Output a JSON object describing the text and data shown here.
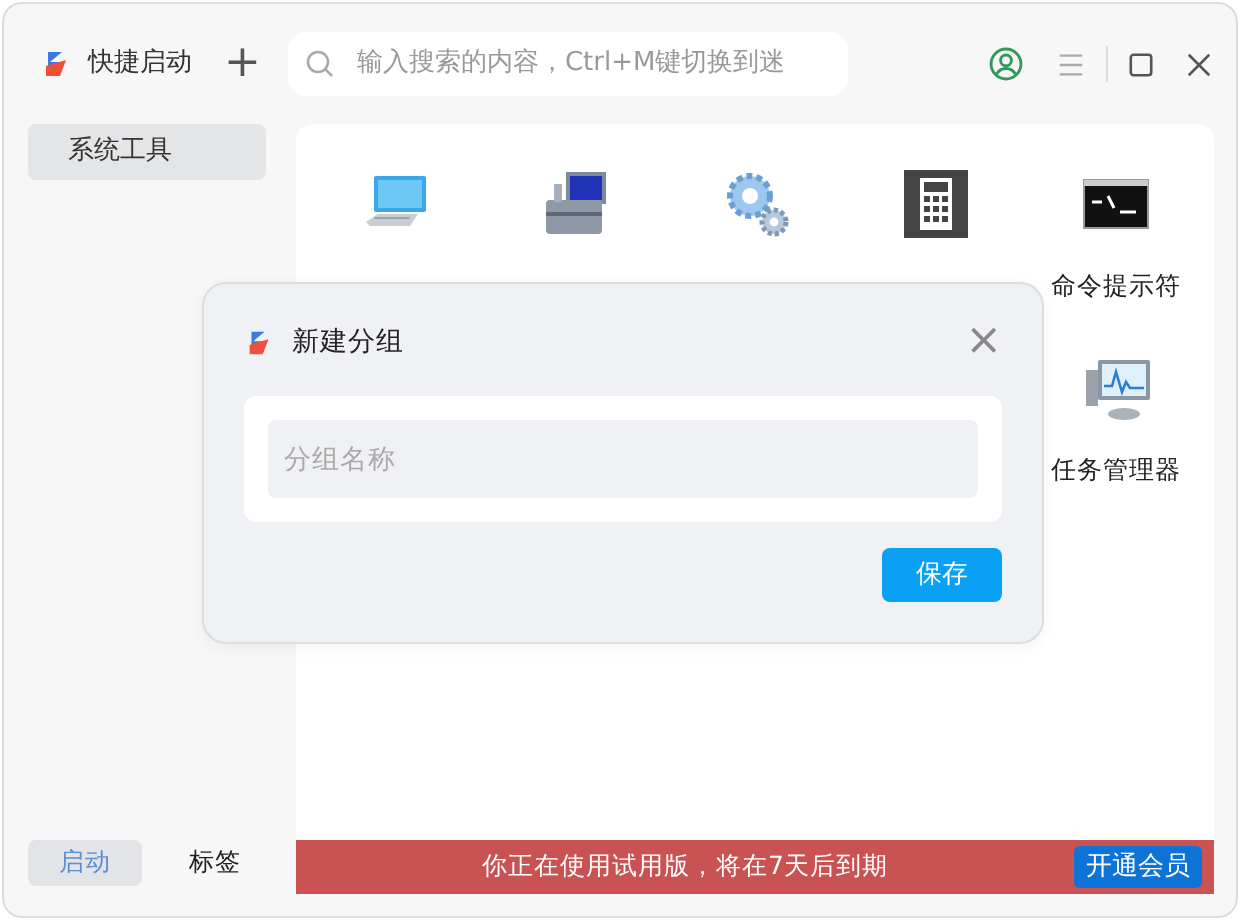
{
  "app": {
    "title": "快捷启动",
    "add": "+"
  },
  "search": {
    "placeholder": "输入搜索的内容，Ctrl+M键切换到迷"
  },
  "groups": [
    {
      "label": "系统工具",
      "selected": true
    }
  ],
  "launchers": [
    {
      "kind": "computer"
    },
    {
      "kind": "toolbox"
    },
    {
      "kind": "gears"
    },
    {
      "kind": "calculator"
    },
    {
      "kind": "terminal",
      "label": "命令提示符"
    },
    {
      "kind": "monitor",
      "label": "任务管理器"
    }
  ],
  "bottom_tabs": [
    {
      "label": "启动",
      "selected": true
    },
    {
      "label": "标签",
      "selected": false
    }
  ],
  "trial_banner": {
    "message": "你正在使用试用版，将在7天后到期",
    "button": "开通会员"
  },
  "dialog": {
    "title": "新建分组",
    "close": "×",
    "field": {
      "placeholder": "分组名称"
    },
    "save_button": "保存"
  }
}
